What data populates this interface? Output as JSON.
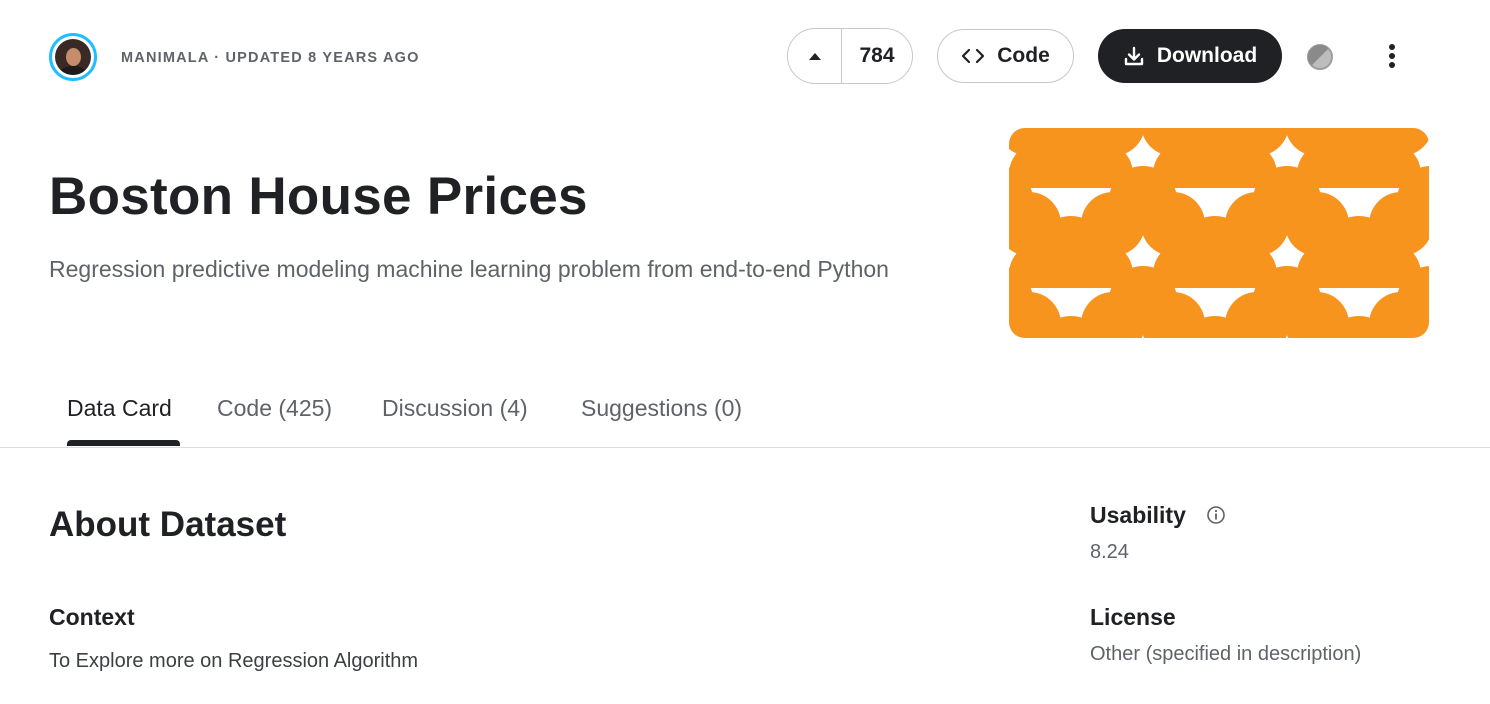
{
  "header": {
    "owner_line": "MANIMALA · UPDATED 8 YEARS AGO",
    "vote_count": "784",
    "code_label": "Code",
    "download_label": "Download"
  },
  "dataset": {
    "title": "Boston House Prices",
    "subtitle": "Regression predictive modeling machine learning problem from end-to-end Python",
    "banner_color": "#f7941d"
  },
  "tabs": [
    {
      "label": "Data Card",
      "active": true
    },
    {
      "label": "Code (425)",
      "active": false
    },
    {
      "label": "Discussion (4)",
      "active": false
    },
    {
      "label": "Suggestions (0)",
      "active": false
    }
  ],
  "about": {
    "heading": "About Dataset",
    "context_heading": "Context",
    "context_text": "To Explore more on Regression Algorithm"
  },
  "sidebar": {
    "usability_label": "Usability",
    "usability_value": "8.24",
    "license_label": "License",
    "license_value": "Other (specified in description)"
  },
  "icons": [
    "avatar",
    "arrow-up-icon",
    "code-icon",
    "download-icon",
    "theme-toggle-icon",
    "more-vert-icon",
    "info-icon"
  ]
}
